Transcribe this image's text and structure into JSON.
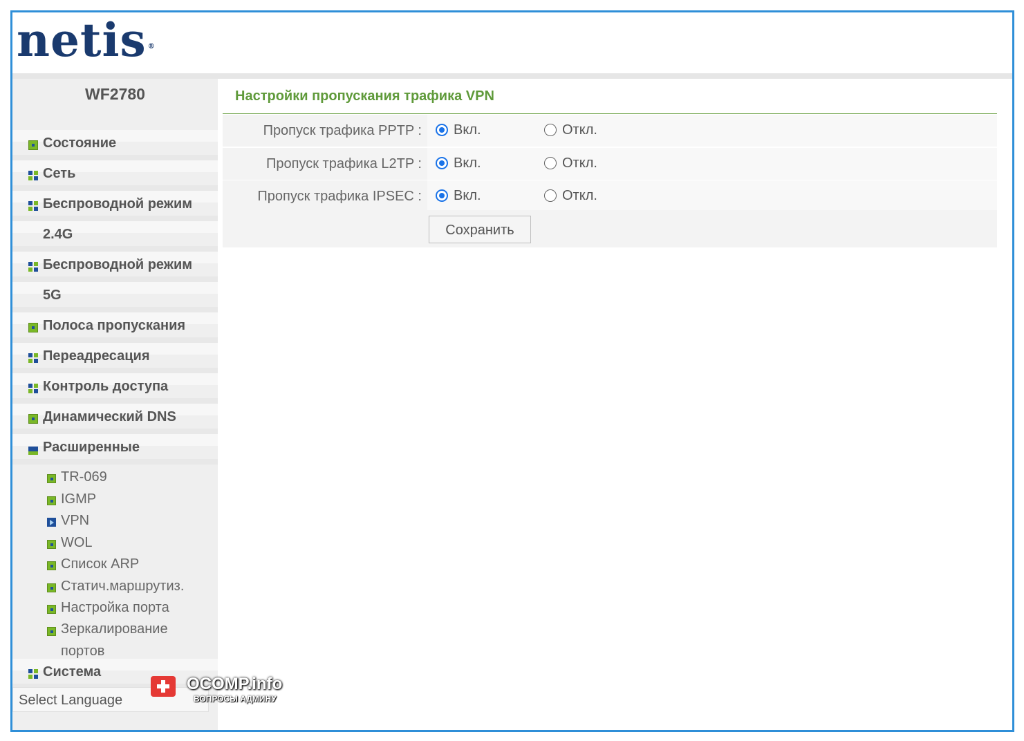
{
  "brand": {
    "logo": "netis",
    "reg": "®"
  },
  "sidebar": {
    "model": "WF2780",
    "items": [
      {
        "label": "Состояние",
        "icon": "plus-box-icon"
      },
      {
        "label": "Сеть",
        "icon": "grid-icon"
      },
      {
        "label": "Беспроводной режим",
        "icon": "grid-icon"
      },
      {
        "label": "2.4G",
        "icon": ""
      },
      {
        "label": "Беспроводной режим",
        "icon": "grid-icon"
      },
      {
        "label": "5G",
        "icon": ""
      },
      {
        "label": "Полоса пропускания",
        "icon": "plus-box-icon"
      },
      {
        "label": "Переадресация",
        "icon": "grid-icon"
      },
      {
        "label": "Контроль доступа",
        "icon": "grid-icon"
      },
      {
        "label": "Динамический DNS",
        "icon": "plus-box-icon"
      },
      {
        "label": "Расширенные",
        "icon": "minus-box-icon"
      }
    ],
    "subitems": [
      {
        "label": "TR-069"
      },
      {
        "label": "IGMP"
      },
      {
        "label": "VPN"
      },
      {
        "label": "WOL"
      },
      {
        "label": "Список ARP"
      },
      {
        "label": "Статич.маршрутиз."
      },
      {
        "label": "Настройка порта"
      },
      {
        "label": "Зеркалирование портов"
      }
    ],
    "system": "Система",
    "language": "Select Language"
  },
  "main": {
    "title": "Настройки пропускания трафика VPN",
    "rows": [
      {
        "label": "Пропуск трафика PPTP :",
        "on": "Вкл.",
        "off": "Откл.",
        "selected": "on"
      },
      {
        "label": "Пропуск трафика L2TP :",
        "on": "Вкл.",
        "off": "Откл.",
        "selected": "on"
      },
      {
        "label": "Пропуск трафика IPSEC :",
        "on": "Вкл.",
        "off": "Откл.",
        "selected": "on"
      }
    ],
    "save": "Сохранить"
  },
  "watermark": {
    "line1": "OCOMP.info",
    "line2": "ВОПРОСЫ АДМИНУ"
  },
  "colors": {
    "frame": "#2f8fd8",
    "title": "#5f9a3a",
    "logo": "#1a3a6e",
    "radio": "#1a73e8"
  }
}
